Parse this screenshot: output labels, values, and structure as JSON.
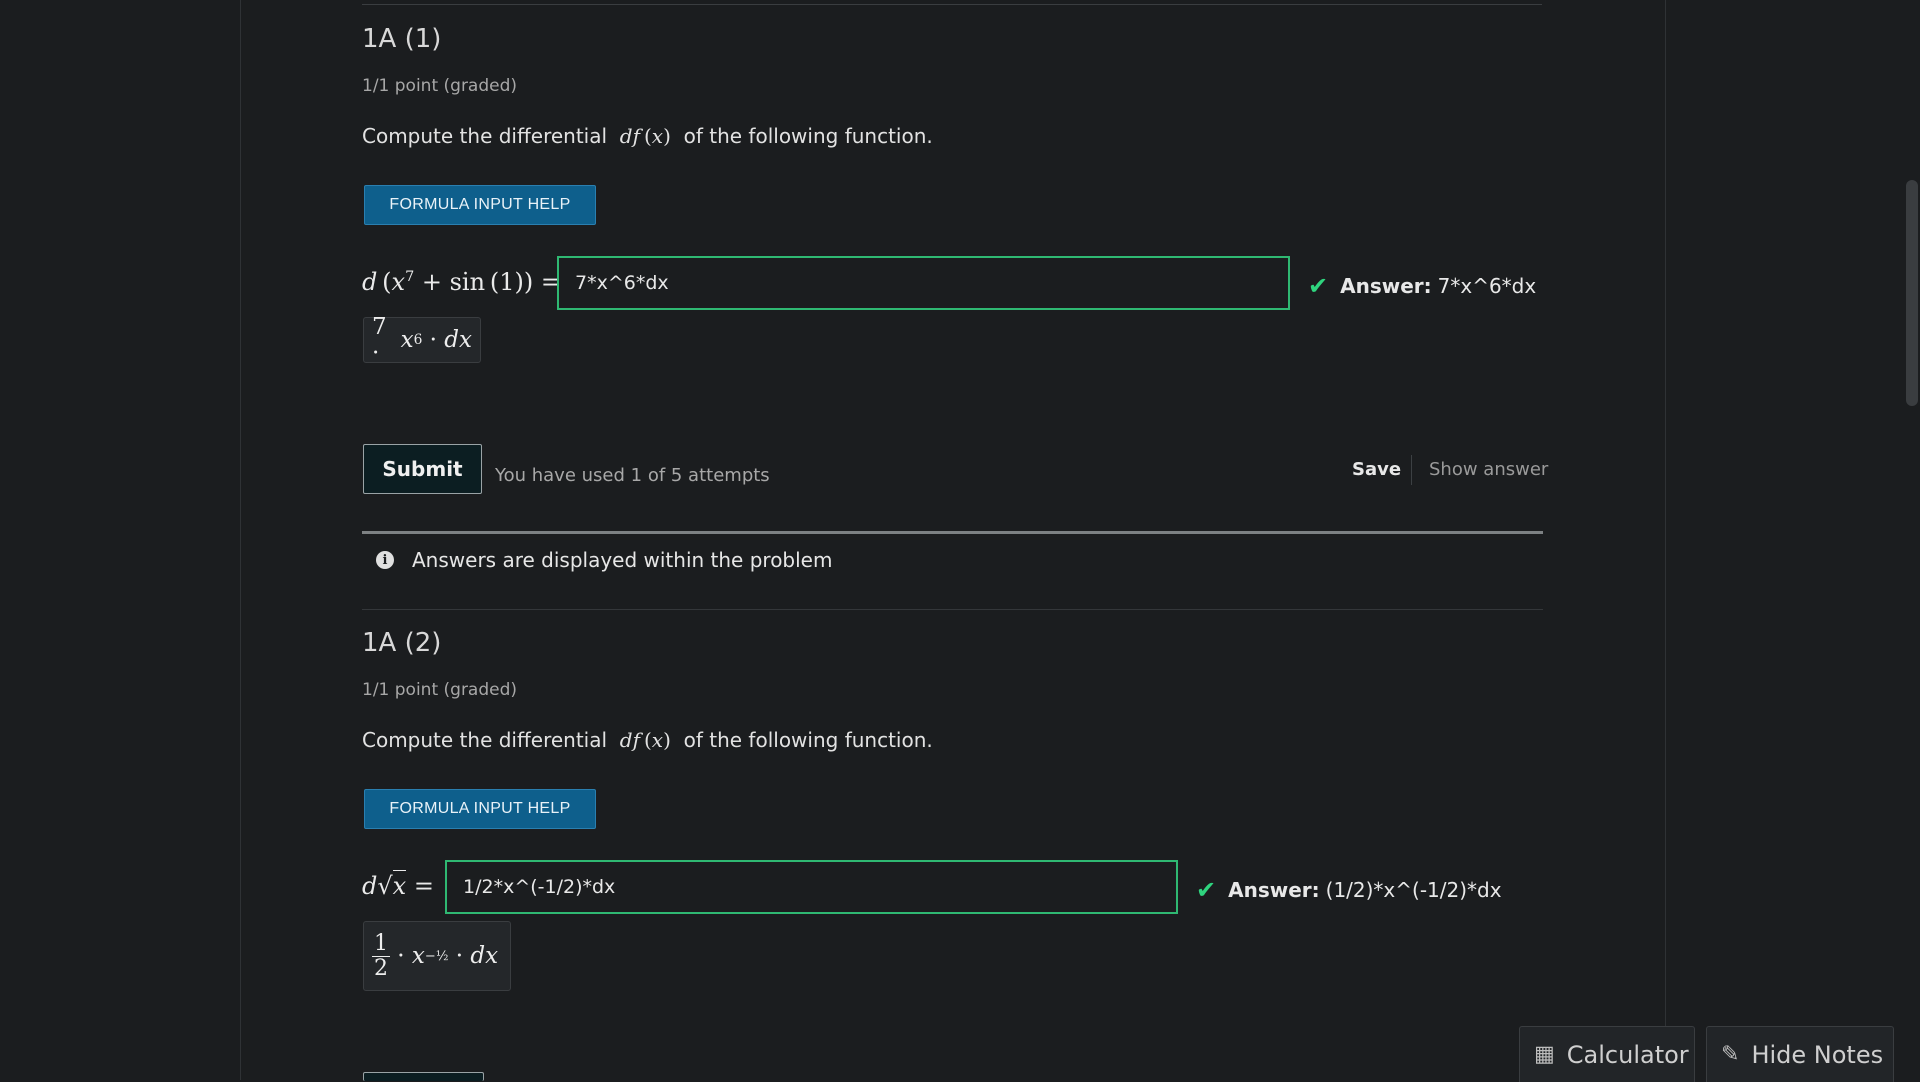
{
  "problems": [
    {
      "title": "1A (1)",
      "points": "1/1 point (graded)",
      "question_prefix": "Compute the differential",
      "question_math": "df(x)",
      "question_suffix": "of the following function.",
      "help_button": "FORMULA INPUT HELP",
      "equation_label": "d(x^7 + sin(1)) =",
      "input_value": "7*x^6*dx",
      "answer_label": "Answer:",
      "answer_value": "7*x^6*dx",
      "preview": "7 · x^6 · dx",
      "submit_label": "Submit",
      "attempts": "You have used 1 of 5 attempts",
      "save_label": "Save",
      "show_answer_label": "Show answer"
    },
    {
      "title": "1A (2)",
      "points": "1/1 point (graded)",
      "question_prefix": "Compute the differential",
      "question_math": "df(x)",
      "question_suffix": "of the following function.",
      "help_button": "FORMULA INPUT HELP",
      "equation_label": "d√x =",
      "input_value": "1/2*x^(-1/2)*dx",
      "answer_label": "Answer:",
      "answer_value": "(1/2)*x^(-1/2)*dx",
      "preview": "1/2 · x^(-1/2) · dx"
    }
  ],
  "notice": {
    "text": "Answers are displayed within the problem",
    "icon": "info-icon"
  },
  "dock": {
    "calculator_label": "Calculator",
    "calculator_icon": "calculator-icon",
    "notes_label": "Hide Notes",
    "notes_icon": "pencil-icon"
  },
  "colors": {
    "background": "#1b1d1f",
    "accent_blue": "#0e5f8c",
    "correct_green": "#2fb872"
  }
}
